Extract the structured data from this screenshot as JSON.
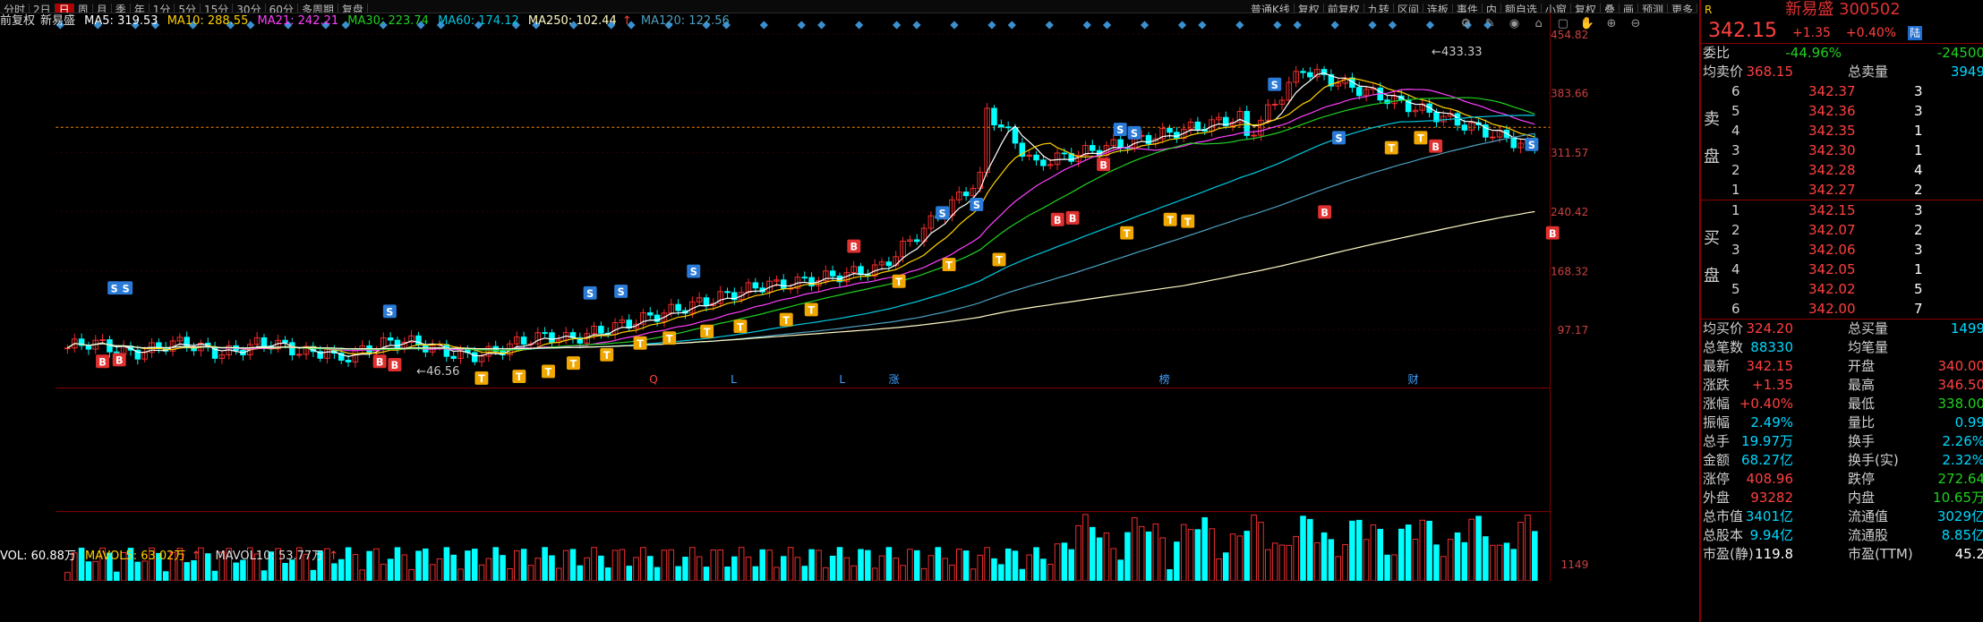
{
  "toolbar": {
    "items": [
      "分时",
      "2日",
      "日",
      "周",
      "月",
      "季",
      "年",
      "1分",
      "5分",
      "15分",
      "30分",
      "60分",
      "多周期",
      "复盘"
    ],
    "active_index": 2,
    "right_items": [
      "普通K线",
      "复权",
      "前复权",
      "九转",
      "区间",
      "连板",
      "事件",
      "内",
      "额自选",
      "小窗",
      "复权",
      "叠",
      "画",
      "预测",
      "更多"
    ]
  },
  "legend": {
    "prefix": "前复权",
    "stock": "新易盛",
    "ma5": "MA5: 319.53",
    "ma10": "MA10: 288.55",
    "ma21": "MA21: 242.21",
    "ma30": "MA30: 223.74",
    "ma60": "MA60: 174.12",
    "ma250": "MA250: 102.44",
    "ma120": "MA120: 122.56",
    "arrow": "↑"
  },
  "colors": {
    "ma5": "#ffffff",
    "ma10": "#ffd000",
    "ma21": "#ff40ff",
    "ma30": "#20d020",
    "ma60": "#00c8e0",
    "ma120": "#4aa0c0",
    "ma250": "#fffbc8",
    "up": "#ff3030",
    "down": "#00ffff"
  },
  "price_axis": [
    "454.82",
    "383.66",
    "311.57",
    "240.42",
    "168.32",
    "97.17"
  ],
  "annotations": {
    "high": "433.33",
    "low": "46.56",
    "current": "342.15"
  },
  "event_markers": [
    "Q",
    "L",
    "L",
    "涨",
    "榜",
    "财"
  ],
  "volume_legend": {
    "vol": "VOL: 60.88万",
    "mavol5": "MAVOL5: 63.02万",
    "mavol10": "MAVOL10: 53.77万",
    "arrow": "↑",
    "axis_top": "1149"
  },
  "tool_icons": [
    "gear-icon",
    "pencil-icon",
    "eye-icon",
    "bank-icon",
    "delete-icon",
    "hand-icon",
    "zoom-in-icon",
    "zoom-out-icon"
  ],
  "quote": {
    "r_badge": "R",
    "title": "新易盛 300502",
    "price": "342.15",
    "change": "+1.35",
    "change_pct": "+0.40%",
    "lu_badge": "陆",
    "weibi_label": "委比",
    "weibi": "-44.96%",
    "weicha": "-24500",
    "avg_sell_label": "均卖价",
    "avg_sell": "368.15",
    "total_sell_label": "总卖量",
    "total_sell": "3949",
    "sell_label_1": "卖",
    "sell_label_2": "盘",
    "sells": [
      {
        "lvl": "6",
        "price": "342.37",
        "qty": "3"
      },
      {
        "lvl": "5",
        "price": "342.36",
        "qty": "3"
      },
      {
        "lvl": "4",
        "price": "342.35",
        "qty": "1"
      },
      {
        "lvl": "3",
        "price": "342.30",
        "qty": "1"
      },
      {
        "lvl": "2",
        "price": "342.28",
        "qty": "4"
      },
      {
        "lvl": "1",
        "price": "342.27",
        "qty": "2"
      }
    ],
    "buy_label_1": "买",
    "buy_label_2": "盘",
    "buys": [
      {
        "lvl": "1",
        "price": "342.15",
        "qty": "3"
      },
      {
        "lvl": "2",
        "price": "342.07",
        "qty": "2"
      },
      {
        "lvl": "3",
        "price": "342.06",
        "qty": "3"
      },
      {
        "lvl": "4",
        "price": "342.05",
        "qty": "1"
      },
      {
        "lvl": "5",
        "price": "342.02",
        "qty": "5"
      },
      {
        "lvl": "6",
        "price": "342.00",
        "qty": "7"
      }
    ],
    "stats": [
      {
        "l": "均买价",
        "v": "324.20",
        "c": "red",
        "l2": "总买量",
        "v2": "1499",
        "c2": "cyan"
      },
      {
        "l": "总笔数",
        "v": "88330",
        "c": "cyan",
        "l2": "均笔量",
        "v2": "",
        "c2": "white"
      },
      {
        "l": "最新",
        "v": "342.15",
        "c": "red",
        "l2": "开盘",
        "v2": "340.00",
        "c2": "red"
      },
      {
        "l": "涨跌",
        "v": "+1.35",
        "c": "red",
        "l2": "最高",
        "v2": "346.50",
        "c2": "red"
      },
      {
        "l": "涨幅",
        "v": "+0.40%",
        "c": "red",
        "l2": "最低",
        "v2": "338.00",
        "c2": "green"
      },
      {
        "l": "振幅",
        "v": "2.49%",
        "c": "cyan",
        "l2": "量比",
        "v2": "0.99",
        "c2": "cyan"
      },
      {
        "l": "总手",
        "v": "19.97万",
        "c": "cyan",
        "l2": "换手",
        "v2": "2.26%",
        "c2": "cyan"
      },
      {
        "l": "金额",
        "v": "68.27亿",
        "c": "cyan",
        "l2": "换手(实)",
        "v2": "2.32%",
        "c2": "cyan"
      },
      {
        "l": "涨停",
        "v": "408.96",
        "c": "red",
        "l2": "跌停",
        "v2": "272.64",
        "c2": "green"
      },
      {
        "l": "外盘",
        "v": "93282",
        "c": "red",
        "l2": "内盘",
        "v2": "10.65万",
        "c2": "green"
      },
      {
        "l": "总市值",
        "v": "3401亿",
        "c": "cyan",
        "l2": "流通值",
        "v2": "3029亿",
        "c2": "cyan"
      },
      {
        "l": "总股本",
        "v": "9.94亿",
        "c": "cyan",
        "l2": "流通股",
        "v2": "8.85亿",
        "c2": "cyan"
      },
      {
        "l": "市盈(静)",
        "v": "119.8",
        "c": "white",
        "l2": "市盈(TTM)",
        "v2": "45.2",
        "c2": "white"
      }
    ]
  }
}
